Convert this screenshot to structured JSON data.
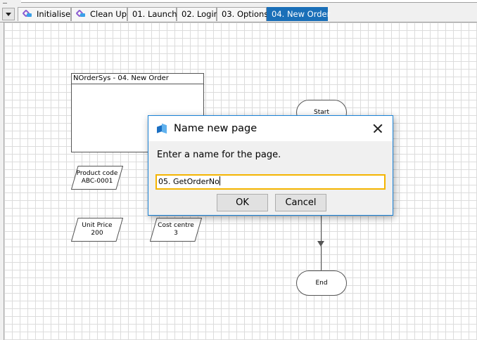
{
  "tabs": [
    {
      "label": "Initialise",
      "icon": "process-icon"
    },
    {
      "label": "Clean Up",
      "icon": "process-icon"
    },
    {
      "label": "01. Launch"
    },
    {
      "label": "02. Login"
    },
    {
      "label": "03. Options"
    },
    {
      "label": "04. New Order",
      "active": true
    }
  ],
  "canvas": {
    "info_title": "NOrderSys - 04. New Order",
    "start_label": "Start",
    "end_label": "End",
    "shapes": [
      {
        "name": "Product code",
        "value": "ABC-0001"
      },
      {
        "name": "Unit Price",
        "value": "200"
      },
      {
        "name": "Cost centre",
        "value": "3"
      }
    ]
  },
  "dialog": {
    "title": "Name new page",
    "prompt": "Enter a name for the page.",
    "input_value": "05. GetOrderNo",
    "ok_label": "OK",
    "cancel_label": "Cancel"
  },
  "colors": {
    "active_tab": "#1a6fb8",
    "focus_border": "#f4b400",
    "dialog_border": "#1a82d6"
  }
}
